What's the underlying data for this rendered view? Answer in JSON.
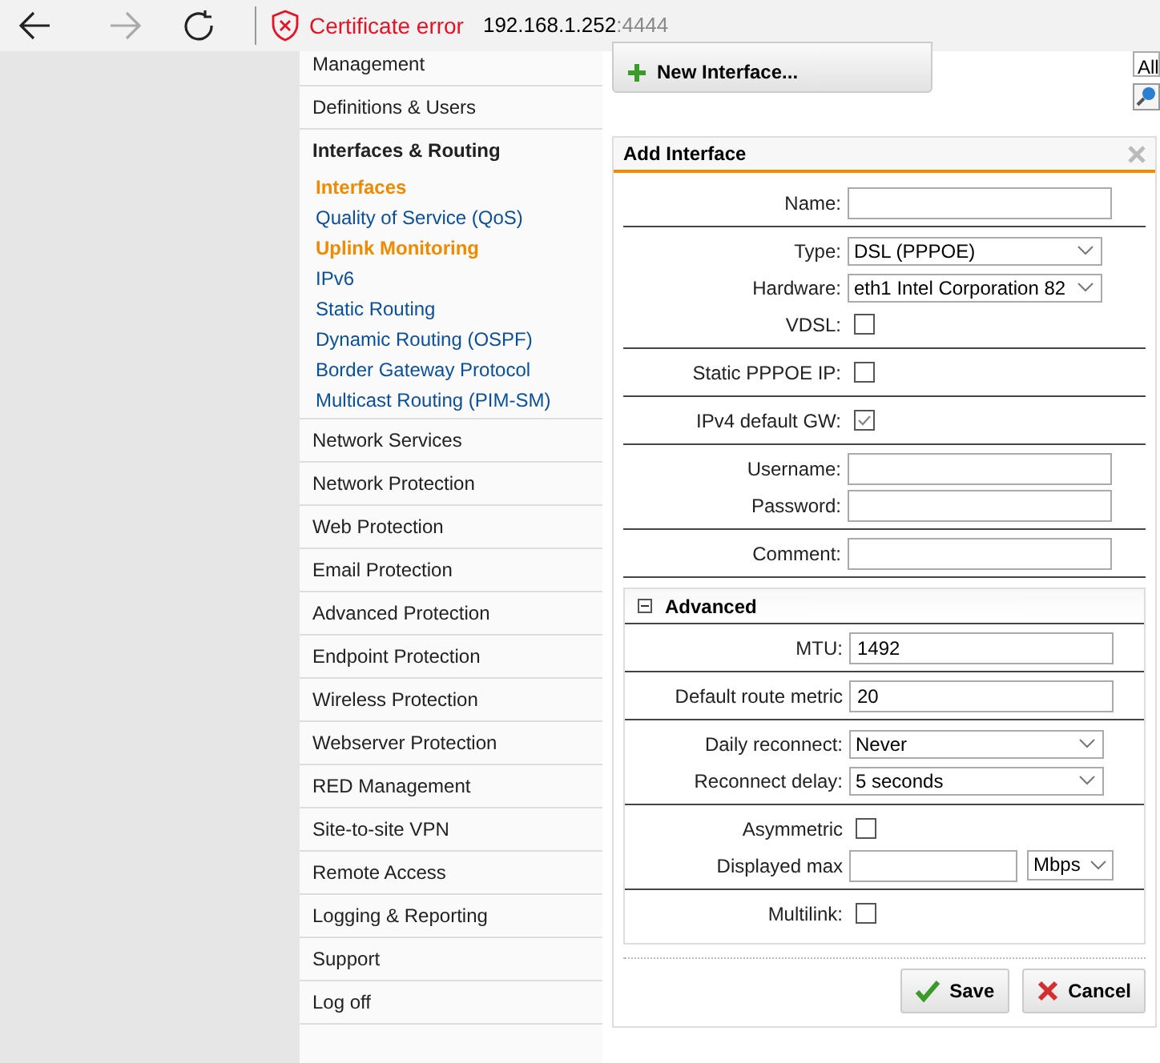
{
  "browser": {
    "forward_disabled": true,
    "certificate_error": "Certificate error",
    "address_host": "192.168.1.252",
    "address_port": ":4444"
  },
  "sidebar": {
    "items": [
      {
        "label": "Management"
      },
      {
        "label": "Definitions & Users"
      },
      {
        "label": "Interfaces & Routing",
        "expanded": true,
        "children": [
          {
            "label": "Interfaces",
            "highlighted": true
          },
          {
            "label": "Quality of Service (QoS)",
            "highlighted": false
          },
          {
            "label": "Uplink Monitoring",
            "highlighted": true
          },
          {
            "label": "IPv6",
            "highlighted": false
          },
          {
            "label": "Static Routing",
            "highlighted": false
          },
          {
            "label": "Dynamic Routing (OSPF)",
            "highlighted": false
          },
          {
            "label": "Border Gateway Protocol",
            "highlighted": false
          },
          {
            "label": "Multicast Routing (PIM-SM)",
            "highlighted": false
          }
        ]
      },
      {
        "label": "Network Services"
      },
      {
        "label": "Network Protection"
      },
      {
        "label": "Web Protection"
      },
      {
        "label": "Email Protection"
      },
      {
        "label": "Advanced Protection"
      },
      {
        "label": "Endpoint Protection"
      },
      {
        "label": "Wireless Protection"
      },
      {
        "label": "Webserver Protection"
      },
      {
        "label": "RED Management"
      },
      {
        "label": "Site-to-site VPN"
      },
      {
        "label": "Remote Access"
      },
      {
        "label": "Logging & Reporting"
      },
      {
        "label": "Support"
      },
      {
        "label": "Log off"
      }
    ]
  },
  "toolbar": {
    "new_button": "New Interface...",
    "filter_value": "All"
  },
  "dialog": {
    "title": "Add Interface",
    "groups": [
      {
        "fields": [
          {
            "label": "Name:",
            "kind": "text"
          }
        ]
      },
      {
        "fields": [
          {
            "label": "Type:",
            "kind": "select",
            "value": "DSL (PPPOE)"
          },
          {
            "label": "Hardware:",
            "kind": "select",
            "value": "eth1 Intel Corporation 82"
          },
          {
            "label": "VDSL:",
            "kind": "checkbox",
            "checked": false
          }
        ]
      },
      {
        "fields": [
          {
            "label": "Static PPPOE IP:",
            "kind": "checkbox",
            "checked": false
          }
        ]
      },
      {
        "fields": [
          {
            "label": "IPv4 default GW:",
            "kind": "checkbox",
            "checked": true
          }
        ]
      },
      {
        "fields": [
          {
            "label": "Username:",
            "kind": "text"
          },
          {
            "label": "Password:",
            "kind": "text"
          }
        ]
      },
      {
        "fields": [
          {
            "label": "Comment:",
            "kind": "text"
          }
        ]
      }
    ],
    "advanced": {
      "title": "Advanced",
      "expanded": true,
      "groups": [
        {
          "fields": [
            {
              "label": "MTU:",
              "kind": "text",
              "value": "1492"
            }
          ]
        },
        {
          "fields": [
            {
              "label": "Default route metric",
              "kind": "text",
              "value": "20"
            }
          ]
        },
        {
          "fields": [
            {
              "label": "Daily reconnect:",
              "kind": "select",
              "value": "Never"
            },
            {
              "label": "Reconnect delay:",
              "kind": "select",
              "value": "5 seconds"
            }
          ]
        },
        {
          "fields": [
            {
              "label": "Asymmetric",
              "kind": "checkbox",
              "checked": false
            },
            {
              "label": "Displayed max",
              "kind": "text_unit",
              "unit": "Mbps"
            }
          ]
        },
        {
          "fields": [
            {
              "label": "Multilink:",
              "kind": "checkbox",
              "checked": false
            }
          ]
        }
      ]
    },
    "buttons": [
      {
        "label": "Save",
        "kind": "save"
      },
      {
        "label": "Cancel",
        "kind": "cancel"
      }
    ]
  }
}
